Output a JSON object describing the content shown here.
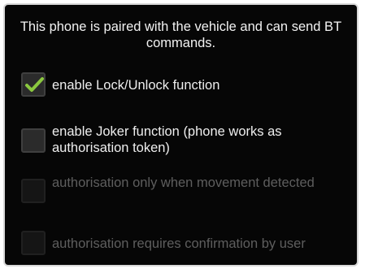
{
  "dialog": {
    "message": "This phone is paired with the vehicle and can send BT commands."
  },
  "options": [
    {
      "label": "enable Lock/Unlock function",
      "checked": true,
      "enabled": true
    },
    {
      "label": "enable Joker function (phone works as authorisation token)",
      "checked": false,
      "enabled": true
    },
    {
      "label": "authorisation only when movement detected",
      "checked": false,
      "enabled": false
    },
    {
      "label": "authorisation requires confirmation by user",
      "checked": false,
      "enabled": false
    }
  ],
  "colors": {
    "background": "#060606",
    "text": "#eeeeee",
    "disabled_text": "#5e5e5e",
    "checkmark": "#8bc83f"
  }
}
